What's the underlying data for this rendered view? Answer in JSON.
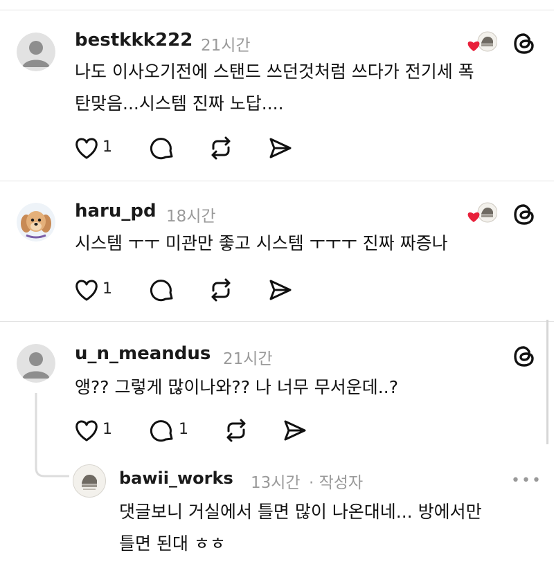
{
  "comments": [
    {
      "username": "bestkkk222",
      "time": "21시간",
      "lines": [
        "나도 이사오기전에 스탠드 쓰던것처럼 쓰다가 전기세 폭",
        "탄맞음...시스템 진짜 노답...."
      ],
      "likes": "1",
      "replies": "",
      "avatar": "default-avatar",
      "author_liked": true
    },
    {
      "username": "haru_pd",
      "time": "18시간",
      "lines": [
        "시스템 ㅜㅜ 미관만 좋고 시스템 ㅜㅜㅜ 진짜 짜증나"
      ],
      "likes": "1",
      "replies": "",
      "avatar": "dog-avatar",
      "author_liked": true
    },
    {
      "username": "u_n_meandus",
      "time": "21시간",
      "lines": [
        "앵?? 그렇게 많이나와?? 나 너무 무서운데..?"
      ],
      "likes": "1",
      "replies": "1",
      "avatar": "default-avatar",
      "author_liked": false
    }
  ],
  "reply": {
    "username": "bawii_works",
    "time": "13시간",
    "author_badge": "· 작성자",
    "lines": [
      "댓글보니 거실에서 틀면 많이 나온대네... 방에서만",
      "틀면 된대 ㅎㅎ"
    ],
    "more": "•••"
  },
  "colors": {
    "heart": "#e8203a",
    "muted": "#9a9a9a",
    "text": "#111111"
  },
  "icons": [
    "threads-logo-icon",
    "heart-icon",
    "comment-icon",
    "repost-icon",
    "share-icon"
  ]
}
